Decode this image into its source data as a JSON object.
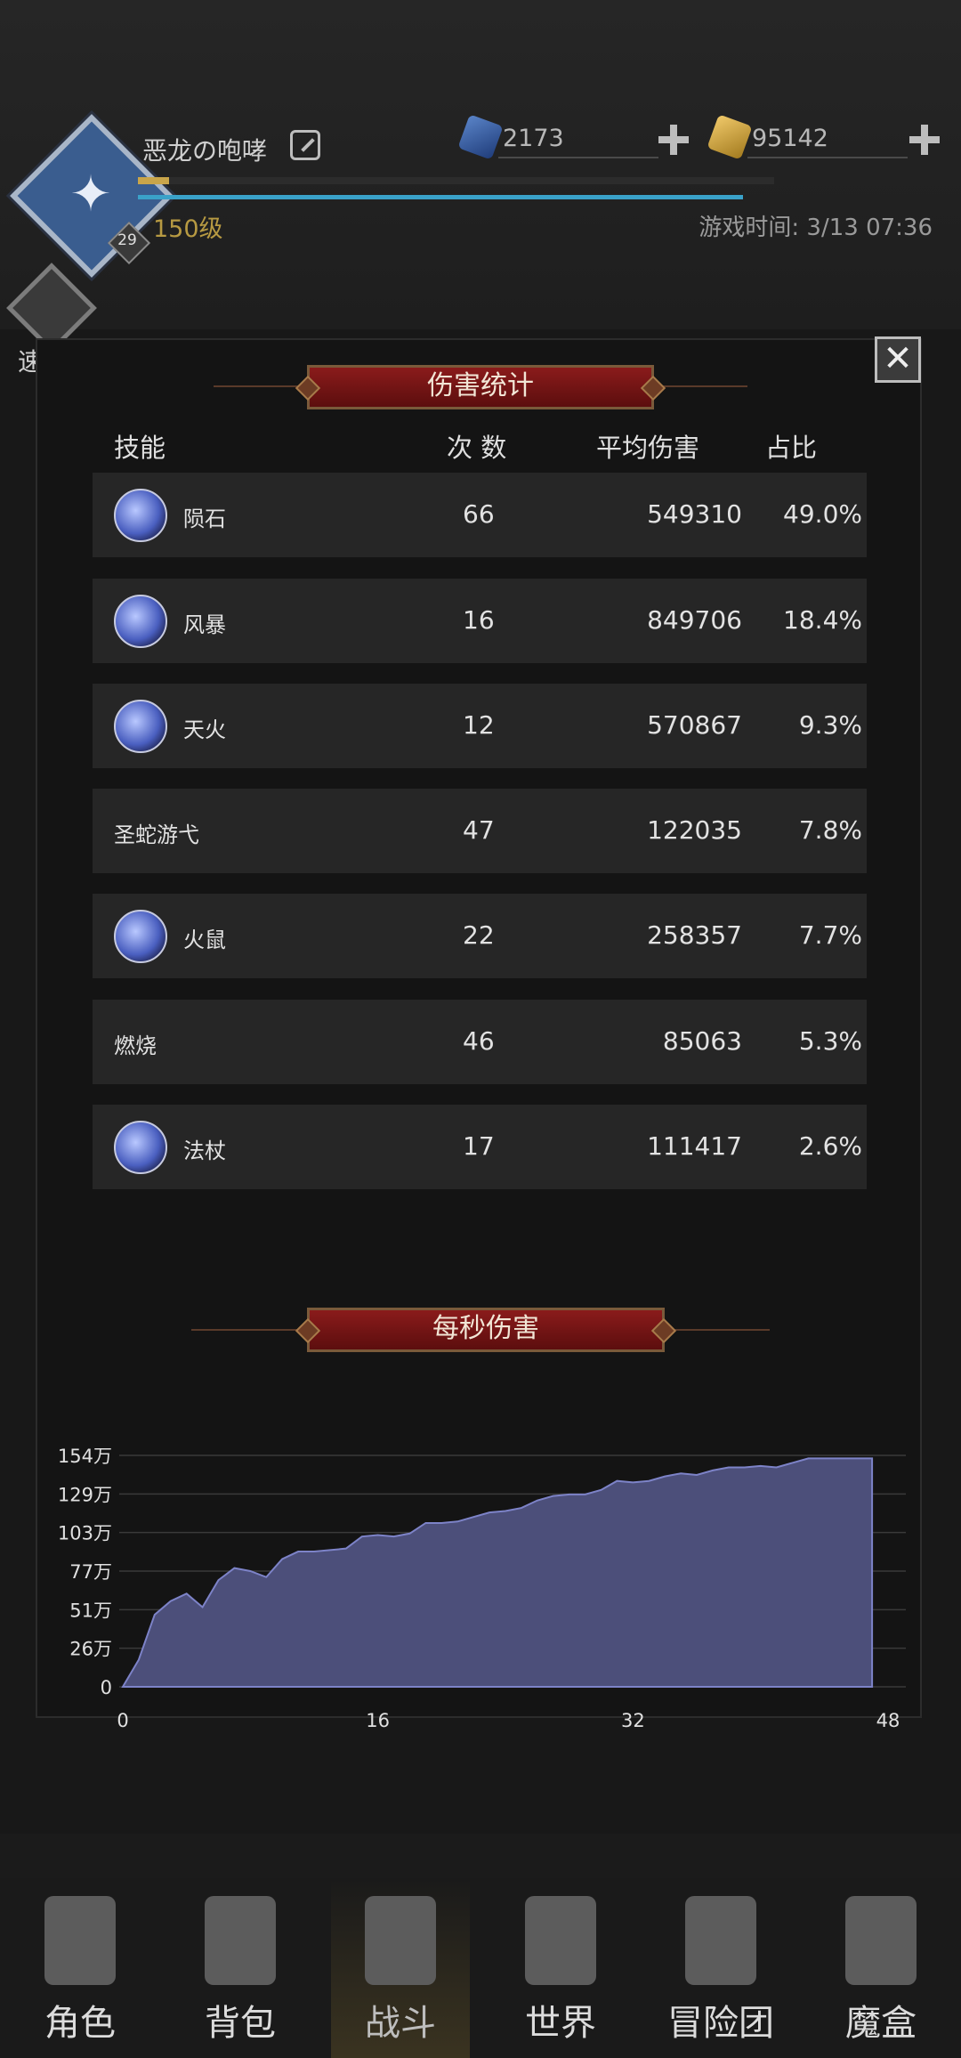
{
  "header": {
    "player_name": "恶龙の咆哮",
    "level_badge": "29",
    "level_text": "150级",
    "game_time": "游戏时间: 3/13 07:36",
    "gems": "2173",
    "gold": "95142",
    "exp_progress": 0.05,
    "secondary_progress": 0.95,
    "quick_battle": "速战"
  },
  "damage_panel": {
    "title": "伤害统计",
    "headers": {
      "skill": "技能",
      "count": "次 数",
      "avg": "平均伤害",
      "share": "占比"
    },
    "rows": [
      {
        "name": "陨石",
        "count": "66",
        "avg": "549310",
        "share": "49.0%",
        "icon": "meteor-icon"
      },
      {
        "name": "风暴",
        "count": "16",
        "avg": "849706",
        "share": "18.4%",
        "icon": "storm-icon"
      },
      {
        "name": "天火",
        "count": "12",
        "avg": "570867",
        "share": "9.3%",
        "icon": "skyfire-icon"
      },
      {
        "name": "圣蛇游弋",
        "count": "47",
        "avg": "122035",
        "share": "7.8%",
        "icon": null
      },
      {
        "name": "火鼠",
        "count": "22",
        "avg": "258357",
        "share": "7.7%",
        "icon": "firerat-icon"
      },
      {
        "name": "燃烧",
        "count": "46",
        "avg": "85063",
        "share": "5.3%",
        "icon": null
      },
      {
        "name": "法杖",
        "count": "17",
        "avg": "111417",
        "share": "2.6%",
        "icon": "staff-icon"
      }
    ]
  },
  "dps_title": "每秒伤害",
  "chart_data": {
    "type": "area",
    "title": "每秒伤害",
    "xlabel": "",
    "ylabel": "",
    "x_ticks": [
      "0",
      "16",
      "32",
      "48"
    ],
    "y_ticks": [
      "0",
      "26万",
      "51万",
      "77万",
      "103万",
      "129万",
      "154万"
    ],
    "xlim": [
      0,
      48
    ],
    "ylim": [
      0,
      154
    ],
    "grid": true,
    "fill_color": "#4c4f7a",
    "line_color": "#7d83c8",
    "x": [
      0,
      1,
      2,
      3,
      4,
      5,
      6,
      7,
      8,
      9,
      10,
      11,
      12,
      13,
      14,
      15,
      16,
      17,
      18,
      19,
      20,
      21,
      22,
      23,
      24,
      25,
      26,
      27,
      28,
      29,
      30,
      31,
      32,
      33,
      34,
      35,
      36,
      37,
      38,
      39,
      40,
      41,
      42,
      43,
      44,
      45,
      46,
      47
    ],
    "y": [
      0,
      18,
      48,
      57,
      62,
      53,
      71,
      79,
      77,
      73,
      85,
      90,
      90,
      91,
      92,
      100,
      101,
      100,
      102,
      109,
      109,
      110,
      113,
      116,
      117,
      119,
      124,
      127,
      128,
      128,
      131,
      137,
      136,
      137,
      140,
      142,
      141,
      144,
      146,
      146,
      147,
      146,
      149,
      152,
      152,
      152,
      152,
      152
    ]
  },
  "nav": {
    "items": [
      {
        "label": "角色",
        "icon": "helmet-icon"
      },
      {
        "label": "背包",
        "icon": "backpack-icon"
      },
      {
        "label": "战斗",
        "icon": "sword-shield-icon"
      },
      {
        "label": "世界",
        "icon": "map-scroll-icon"
      },
      {
        "label": "冒险团",
        "icon": "castle-icon"
      },
      {
        "label": "魔盒",
        "icon": "cube-icon"
      }
    ],
    "active_index": 2
  }
}
